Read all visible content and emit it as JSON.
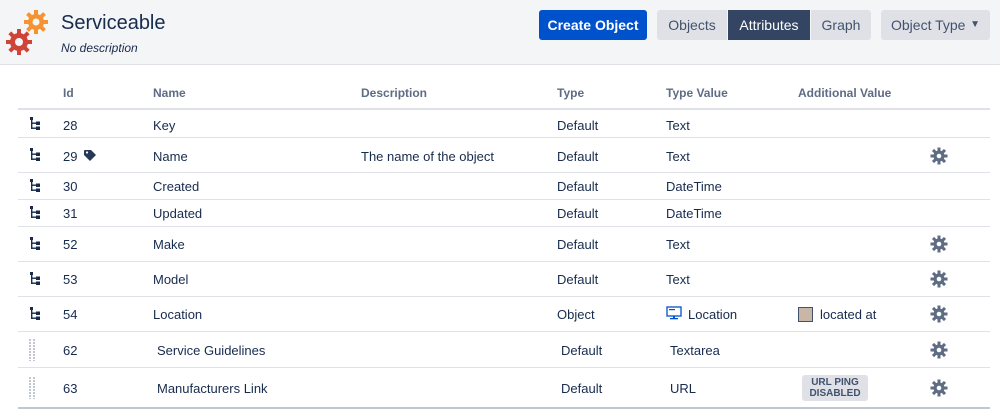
{
  "header": {
    "title": "Serviceable",
    "subtitle": "No description",
    "create_label": "Create Object",
    "objects_label": "Objects",
    "attributes_label": "Attributes",
    "graph_label": "Graph",
    "object_type_label": "Object Type"
  },
  "table": {
    "columns": [
      "Id",
      "Name",
      "Description",
      "Type",
      "Type Value",
      "Additional Value"
    ],
    "rows": [
      {
        "id": "28",
        "name": "Key",
        "description": "",
        "type": "Default",
        "type_value": "Text",
        "additional": "",
        "gear": false
      },
      {
        "id": "29",
        "name": "Name",
        "description": "The name of the object",
        "type": "Default",
        "type_value": "Text",
        "additional": "",
        "gear": true,
        "tag": true
      },
      {
        "id": "30",
        "name": "Created",
        "description": "",
        "type": "Default",
        "type_value": "DateTime",
        "additional": "",
        "gear": false
      },
      {
        "id": "31",
        "name": "Updated",
        "description": "",
        "type": "Default",
        "type_value": "DateTime",
        "additional": "",
        "gear": false
      },
      {
        "id": "52",
        "name": "Make",
        "description": "",
        "type": "Default",
        "type_value": "Text",
        "additional": "",
        "gear": true
      },
      {
        "id": "53",
        "name": "Model",
        "description": "",
        "type": "Default",
        "type_value": "Text",
        "additional": "",
        "gear": true
      },
      {
        "id": "54",
        "name": "Location",
        "description": "",
        "type": "Object",
        "type_value": "Location",
        "additional": "located at",
        "gear": true
      },
      {
        "id": "62",
        "name": "Service Guidelines",
        "description": "",
        "type": "Default",
        "type_value": "Textarea",
        "additional": "",
        "gear": true
      },
      {
        "id": "63",
        "name": "Manufacturers Link",
        "description": "",
        "type": "Default",
        "type_value": "URL",
        "additional": "URL PING DISABLED",
        "gear": true
      }
    ]
  },
  "icons": {
    "logo": "gears-icon",
    "hierarchy": "hierarchy-icon",
    "drag": "drag-handle-icon",
    "gear": "gear-icon",
    "tag": "tag-icon",
    "reference": "monitor-icon"
  },
  "colors": {
    "primary": "#0052cc",
    "selected": "#344563",
    "logo_orange": "#f79232",
    "logo_dark_orange": "#d04437"
  }
}
